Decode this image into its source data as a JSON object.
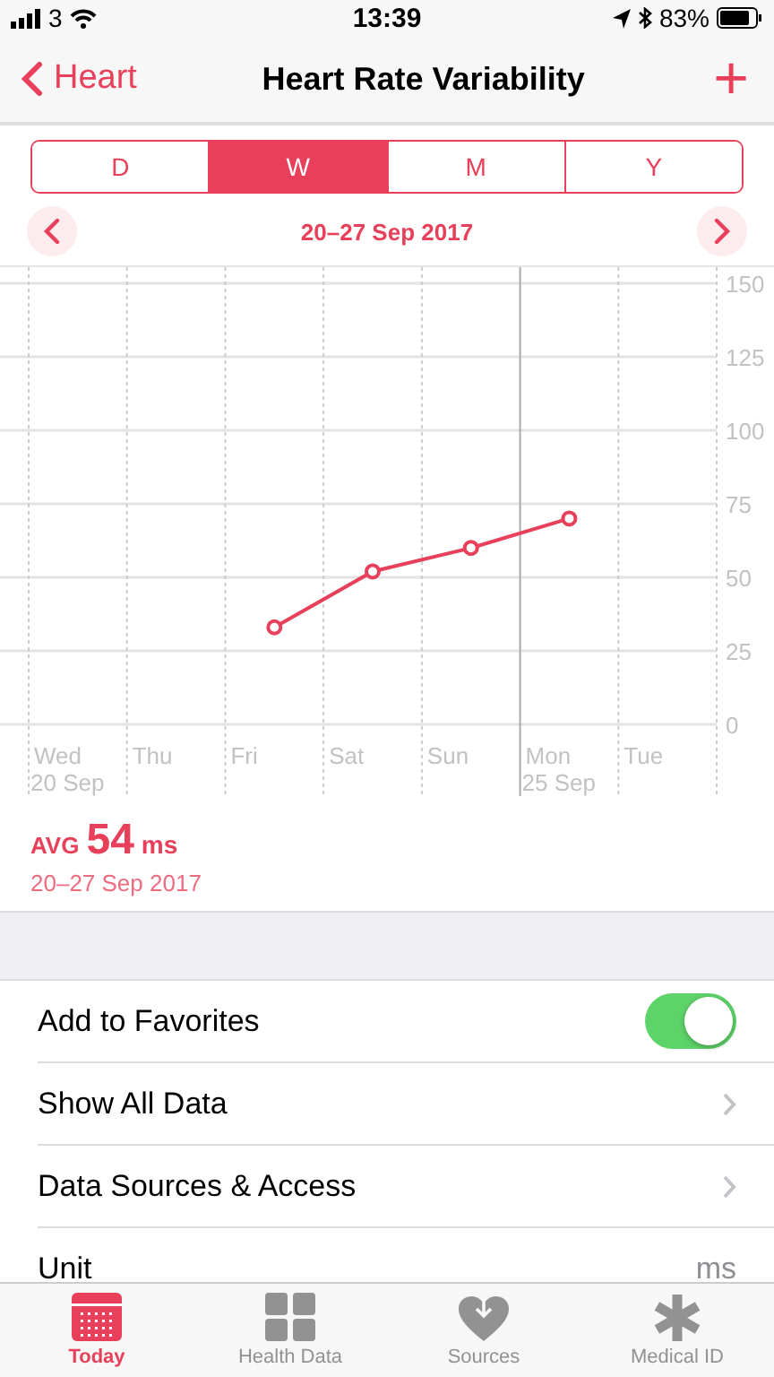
{
  "status_bar": {
    "carrier": "3",
    "time": "13:39",
    "battery": "83%"
  },
  "nav": {
    "back": "Heart",
    "title": "Heart Rate Variability",
    "add": "+"
  },
  "segments": [
    {
      "label": "D",
      "selected": false
    },
    {
      "label": "W",
      "selected": true
    },
    {
      "label": "M",
      "selected": false
    },
    {
      "label": "Y",
      "selected": false
    }
  ],
  "range": "20–27 Sep 2017",
  "chart": {
    "chart_data": {
      "type": "line",
      "categories": [
        "Wed",
        "Thu",
        "Fri",
        "Sat",
        "Sun",
        "Mon",
        "Tue"
      ],
      "series": [
        {
          "color": "#e8405a",
          "marker": "o",
          "values": [
            null,
            null,
            33,
            52,
            60,
            70,
            null
          ]
        }
      ],
      "ylim": [
        0,
        150
      ],
      "grid": true,
      "ref_lines": [
        {
          "axis": "x",
          "value": "Mon",
          "color": "#aaaaaa"
        }
      ],
      "yticks": [
        0,
        25,
        50,
        75,
        100,
        125,
        150
      ]
    },
    "date_labels": [
      "20 Sep",
      "25 Sep"
    ]
  },
  "summary": {
    "label": "AVG",
    "value": "54",
    "unit": "ms",
    "range": "20–27 Sep 2017"
  },
  "rows": [
    {
      "kind": "toggle",
      "label": "Add to Favorites",
      "on": true
    },
    {
      "kind": "link",
      "label": "Show All Data"
    },
    {
      "kind": "link",
      "label": "Data Sources & Access"
    },
    {
      "kind": "value",
      "label": "Unit",
      "value": "ms"
    }
  ],
  "tabs": [
    {
      "label": "Today",
      "selected": true
    },
    {
      "label": "Health Data",
      "selected": false
    },
    {
      "label": "Sources",
      "selected": false
    },
    {
      "label": "Medical ID",
      "selected": false
    }
  ]
}
